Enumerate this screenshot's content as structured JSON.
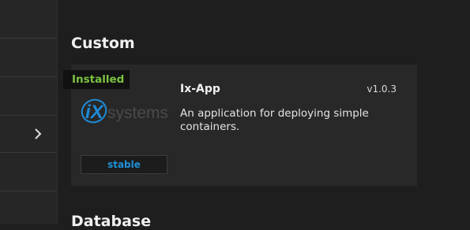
{
  "sections": {
    "custom_title": "Custom",
    "next_title": "Database"
  },
  "app_card": {
    "status_badge": "Installed",
    "name": "Ix-App",
    "version": "v1.0.3",
    "description": "An application for deploying simple containers.",
    "train": "stable",
    "logo": {
      "mark": "iX",
      "wordmark": "systems",
      "mark_color": "#1e8ad6",
      "wordmark_color": "#4a4a4a"
    }
  },
  "colors": {
    "background": "#1e1e1e",
    "sidebar": "#262626",
    "card": "#282828",
    "installed": "#7cc242",
    "accent": "#1e90d8"
  },
  "icons": {
    "sidebar_expand": "chevron-right-icon"
  }
}
